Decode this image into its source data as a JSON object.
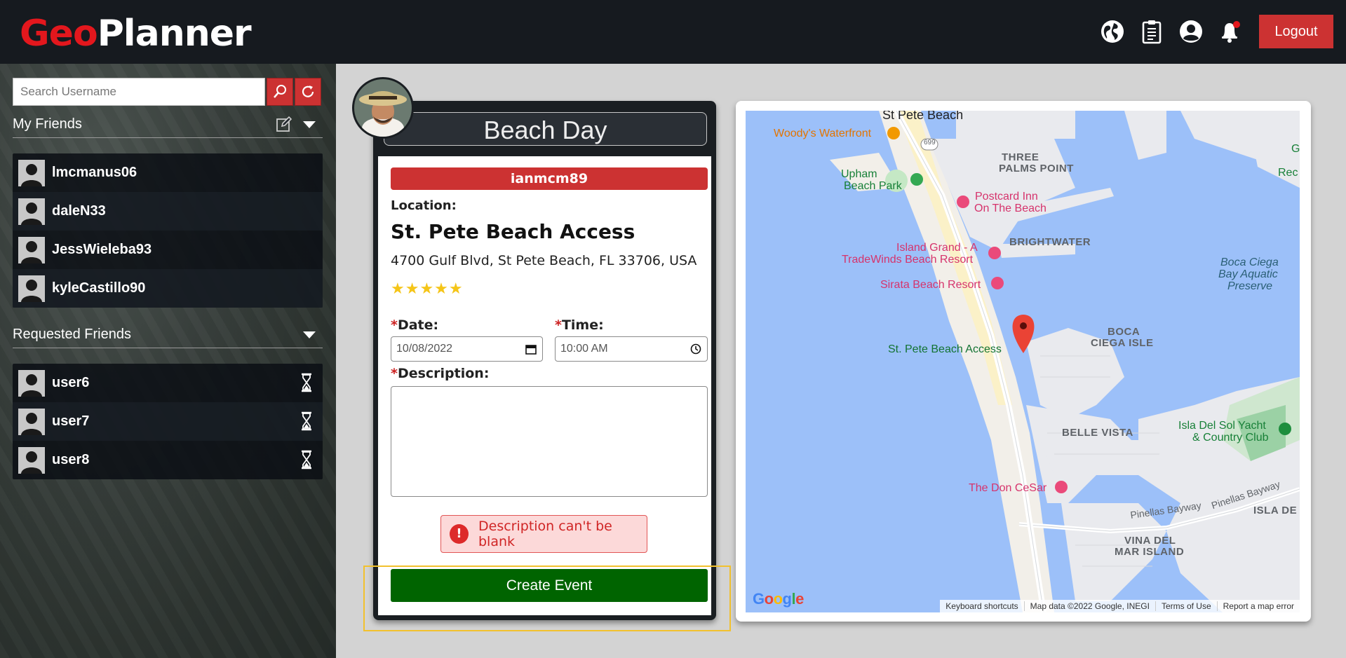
{
  "app": {
    "logo_geo": "Geo",
    "logo_planner": "Planner"
  },
  "header": {
    "icons": [
      "globe-icon",
      "clipboard-icon",
      "user-account-icon",
      "notification-bell-icon"
    ],
    "logout_label": "Logout"
  },
  "sidebar": {
    "search_placeholder": "Search Username",
    "my_friends_title": "My Friends",
    "friends": [
      "lmcmanus06",
      "daleN33",
      "JessWieleba93",
      "kyleCastillo90"
    ],
    "requested_title": "Requested Friends",
    "requested": [
      "user6",
      "user7",
      "user8"
    ]
  },
  "event": {
    "title": "Beach Day",
    "host": "ianmcm89",
    "location_label": "Location:",
    "location_name": "St. Pete Beach Access",
    "address": "4700 Gulf Blvd, St Pete Beach, FL 33706, USA",
    "rating": 5,
    "stars": "★★★★★",
    "date_label": "Date:",
    "date_value": "10/08/2022",
    "time_label": "Time:",
    "time_value": "10:00 AM",
    "description_label": "Description:",
    "description_value": "",
    "required_marker": "*",
    "error_icon": "!",
    "error_message": "Description can't be blank",
    "create_label": "Create Event"
  },
  "map": {
    "labels": {
      "st_pete_beach": "St Pete Beach",
      "woodys": "Woody's Waterfront",
      "upham_1": "Upham",
      "upham_2": "Beach Park",
      "three_palms_1": "THREE",
      "three_palms_2": "PALMS POINT",
      "postcard_1": "Postcard Inn",
      "postcard_2": "On The Beach",
      "brightwater": "BRIGHTWATER",
      "island_grand_1": "Island Grand - A",
      "island_grand_2": "TradeWinds Beach Resort",
      "sirata": "Sirata Beach Resort",
      "boca_aquatic_1": "Boca Ciega",
      "boca_aquatic_2": "Bay Aquatic",
      "boca_aquatic_3": "Preserve",
      "beach_access": "St. Pete Beach Access",
      "boca_isle_1": "BOCA",
      "boca_isle_2": "CIEGA ISLE",
      "belle_vista": "BELLE VISTA",
      "yacht_1": "Isla Del Sol Yacht",
      "yacht_2": "& Country Club",
      "don_cesar": "The Don CeSar",
      "pinellas_1": "Pinellas Bayway",
      "pinellas_2": "Pinellas Bayway",
      "isla_de": "ISLA DE",
      "vina_del_1": "VINA DEL",
      "vina_del_2": "MAR ISLAND",
      "rec": "Rec",
      "g": "G",
      "hwy": "699"
    },
    "google_logo": "Google",
    "footer": [
      "Keyboard shortcuts",
      "Map data ©2022 Google, INEGI",
      "Terms of Use",
      "Report a map error"
    ],
    "colors": {
      "water": "#9cc0f9",
      "land": "#f2efe9",
      "sand": "#fbf1c8",
      "pin": "#ea4335"
    }
  }
}
